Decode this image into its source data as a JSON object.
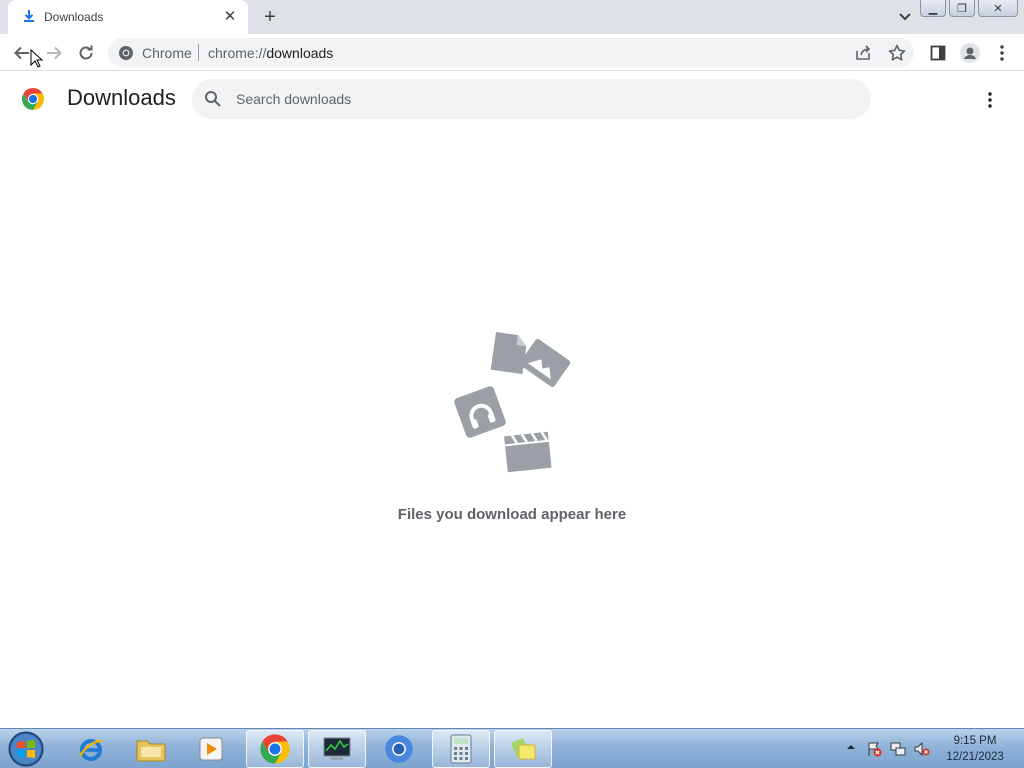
{
  "tab": {
    "title": "Downloads"
  },
  "omnibox": {
    "site_name": "Chrome",
    "url_scheme": "chrome://",
    "url_host": "downloads"
  },
  "page": {
    "title": "Downloads",
    "search_placeholder": "Search downloads",
    "search_value": "",
    "empty_message": "Files you download appear here"
  },
  "taskbar": {
    "items": [
      "start-orb",
      "internet-explorer",
      "file-explorer",
      "media-player",
      "chrome",
      "task-manager",
      "chromium",
      "calculator",
      "sticky-notes"
    ],
    "clock": {
      "time": "9:15 PM",
      "date": "12/21/2023"
    }
  },
  "colors": {
    "accent": "#1a73e8",
    "tab_strip": "#dee1e6",
    "omnibox": "#f1f3f4",
    "empty_illustration": "#9aa0a6",
    "empty_text": "#5f6368"
  }
}
